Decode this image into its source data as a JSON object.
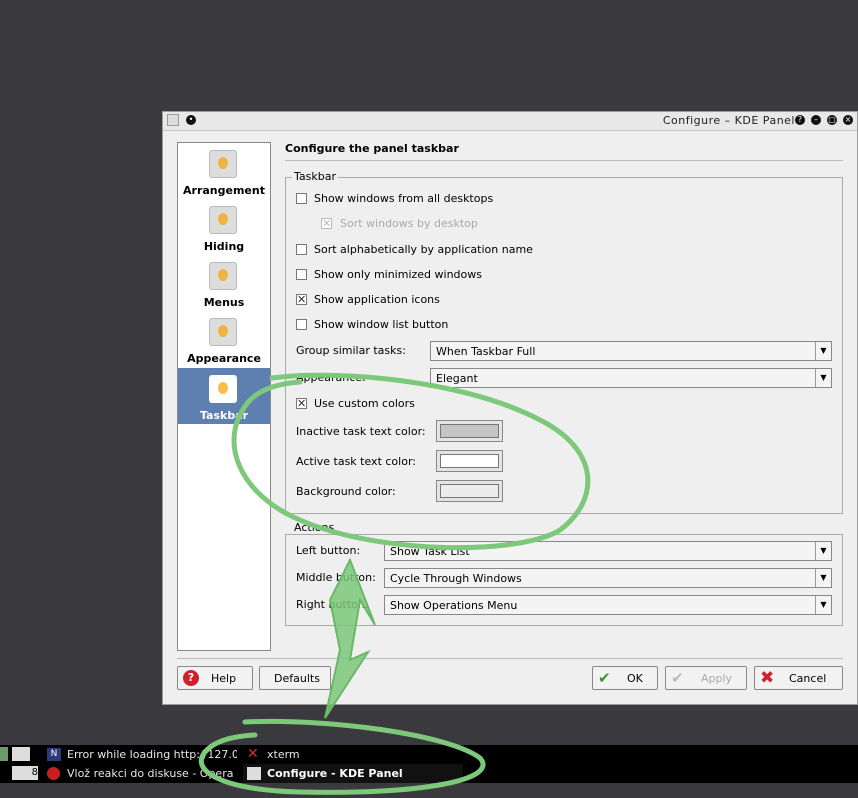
{
  "window": {
    "title": "Configure – KDE Panel",
    "controls": [
      "?",
      "–",
      "▢",
      "×"
    ]
  },
  "sidebar": {
    "items": [
      {
        "label": "Arrangement",
        "icon": "kde-gear-icon",
        "selected": false
      },
      {
        "label": "Hiding",
        "icon": "kde-gear-icon",
        "selected": false
      },
      {
        "label": "Menus",
        "icon": "kde-gear-icon",
        "selected": false
      },
      {
        "label": "Appearance",
        "icon": "kde-gear-icon",
        "selected": false
      },
      {
        "label": "Taskbar",
        "icon": "kde-gear-icon",
        "selected": true
      }
    ]
  },
  "main": {
    "heading": "Configure the panel taskbar",
    "taskbar_group": {
      "title": "Taskbar",
      "checkboxes": [
        {
          "label": "Show windows from all desktops",
          "checked": false,
          "enabled": true
        },
        {
          "label": "Sort windows by desktop",
          "checked": true,
          "enabled": false
        },
        {
          "label": "Sort alphabetically by application name",
          "checked": false,
          "enabled": true
        },
        {
          "label": "Show only minimized windows",
          "checked": false,
          "enabled": true
        },
        {
          "label": "Show application icons",
          "checked": true,
          "enabled": true
        },
        {
          "label": "Show window list button",
          "checked": false,
          "enabled": true
        }
      ],
      "group_similar_label": "Group similar tasks:",
      "group_similar_value": "When Taskbar Full",
      "appearance_label": "Appearance:",
      "appearance_value": "Elegant",
      "custom_colors_label": "Use custom colors",
      "custom_colors_checked": true,
      "inactive_color_label": "Inactive task text color:",
      "active_color_label": "Active task text color:",
      "background_color_label": "Background color:",
      "inactive_color": "#c4c4c4",
      "active_color": "#ffffff",
      "background_color": "#ececec"
    },
    "actions_group": {
      "title": "Actions",
      "left_label": "Left button:",
      "left_value": "Show Task List",
      "middle_label": "Middle button:",
      "middle_value": "Cycle Through Windows",
      "right_label": "Right button:",
      "right_value": "Show Operations Menu"
    }
  },
  "footer": {
    "help": "Help",
    "defaults": "Defaults",
    "ok": "OK",
    "apply": "Apply",
    "cancel": "Cancel"
  },
  "taskbar": {
    "row1": [
      {
        "label": "Error while loading http://127.0",
        "icon": "netscape-icon"
      },
      {
        "label": "xterm",
        "icon": "x-icon"
      }
    ],
    "row2": [
      {
        "label": "Vlož reakci do diskuse - Opera",
        "icon": "opera-icon"
      },
      {
        "label": "Configure - KDE Panel",
        "icon": "kde-icon",
        "active": true
      }
    ],
    "desktop_number": "8"
  },
  "colors": {
    "background": "#3a3a3e",
    "selection": "#5e80b0",
    "annotation": "#7dc87a"
  }
}
